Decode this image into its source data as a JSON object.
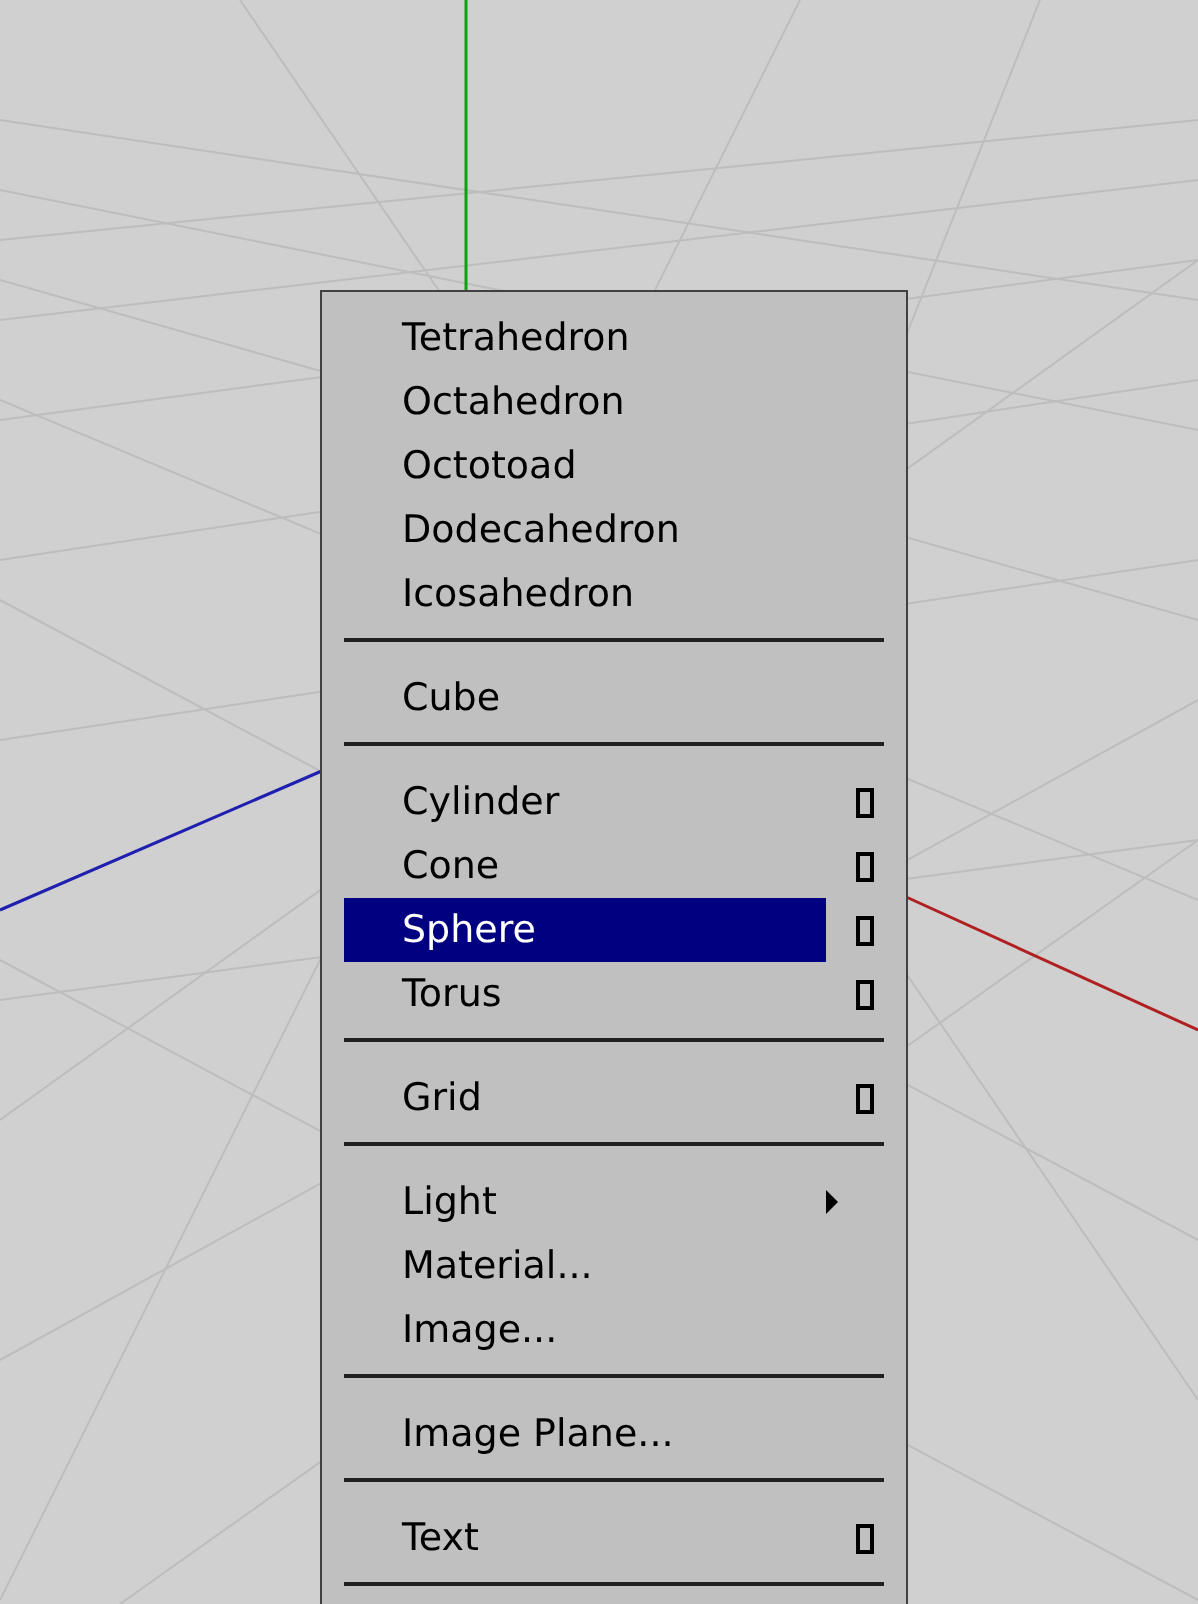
{
  "menu": {
    "groups": [
      {
        "items": [
          {
            "label": "Tetrahedron",
            "kind": "plain",
            "selected": false
          },
          {
            "label": "Octahedron",
            "kind": "plain",
            "selected": false
          },
          {
            "label": "Octotoad",
            "kind": "plain",
            "selected": false
          },
          {
            "label": "Dodecahedron",
            "kind": "plain",
            "selected": false
          },
          {
            "label": "Icosahedron",
            "kind": "plain",
            "selected": false
          }
        ]
      },
      {
        "items": [
          {
            "label": "Cube",
            "kind": "plain",
            "selected": false
          }
        ]
      },
      {
        "items": [
          {
            "label": "Cylinder",
            "kind": "option",
            "selected": false
          },
          {
            "label": "Cone",
            "kind": "option",
            "selected": false
          },
          {
            "label": "Sphere",
            "kind": "option",
            "selected": true
          },
          {
            "label": "Torus",
            "kind": "option",
            "selected": false
          }
        ]
      },
      {
        "items": [
          {
            "label": "Grid",
            "kind": "option",
            "selected": false
          }
        ]
      },
      {
        "items": [
          {
            "label": "Light",
            "kind": "submenu",
            "selected": false
          },
          {
            "label": "Material...",
            "kind": "plain",
            "selected": false
          },
          {
            "label": "Image...",
            "kind": "plain",
            "selected": false
          }
        ]
      },
      {
        "items": [
          {
            "label": "Image Plane...",
            "kind": "plain",
            "selected": false
          }
        ]
      },
      {
        "items": [
          {
            "label": "Text",
            "kind": "option",
            "selected": false
          }
        ]
      }
    ]
  }
}
